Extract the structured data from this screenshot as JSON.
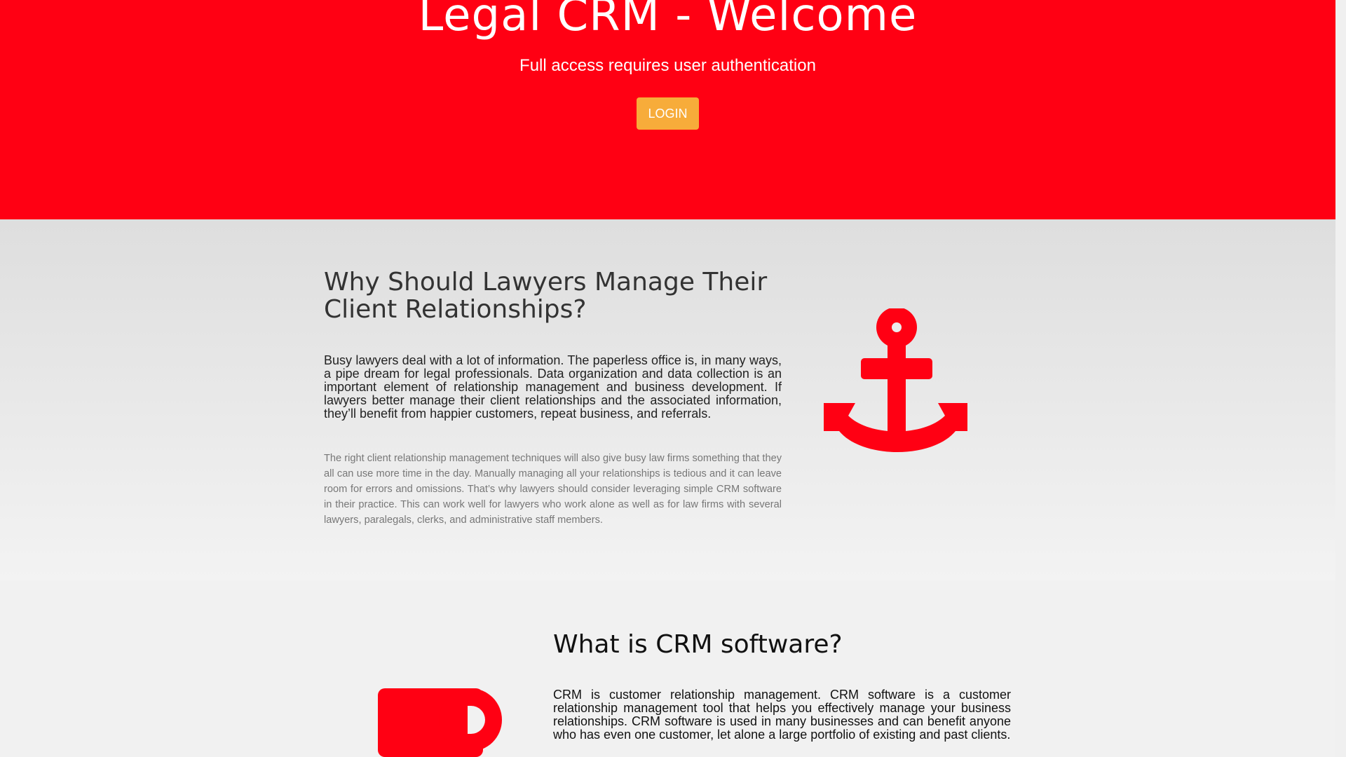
{
  "hero": {
    "title": "Legal CRM - Welcome",
    "subtitle": "Full access requires user authentication",
    "login_label": "LOGIN",
    "background_color": "#ff0013",
    "button_color": "#f7ac3a"
  },
  "why_section": {
    "title": "Why Should Lawyers Manage Their Client Relationships?",
    "lead": "Busy lawyers deal with a lot of information. The paperless office is, in many ways, a pipe dream for legal professionals. Data organization and data collection is an important element of relationship management and business development. If lawyers better manage their client relationships and the associated information, they’ll benefit from happier customers, repeat business, and referrals.",
    "body": "The right client relationship management techniques will also give busy law firms something that they all can use more time in the day. Manually managing all your relationships is tedious and it can leave room for errors and omissions. That’s why lawyers should consider leveraging simple CRM software in their practice. This can work well for lawyers who work alone as well as for law firms with several lawyers, paralegals, clerks, and administrative staff members.",
    "icon": "anchor-icon",
    "icon_color": "#ff0013"
  },
  "crm_section": {
    "title": "What is CRM software?",
    "lead": "CRM is customer relationship management. CRM software is a customer relationship management tool that helps you effectively manage your business relationships. CRM software is used in many businesses and can benefit anyone who has even one customer, let alone a large portfolio of existing and past clients.",
    "icon": "mug-icon",
    "icon_color": "#ff0013"
  }
}
